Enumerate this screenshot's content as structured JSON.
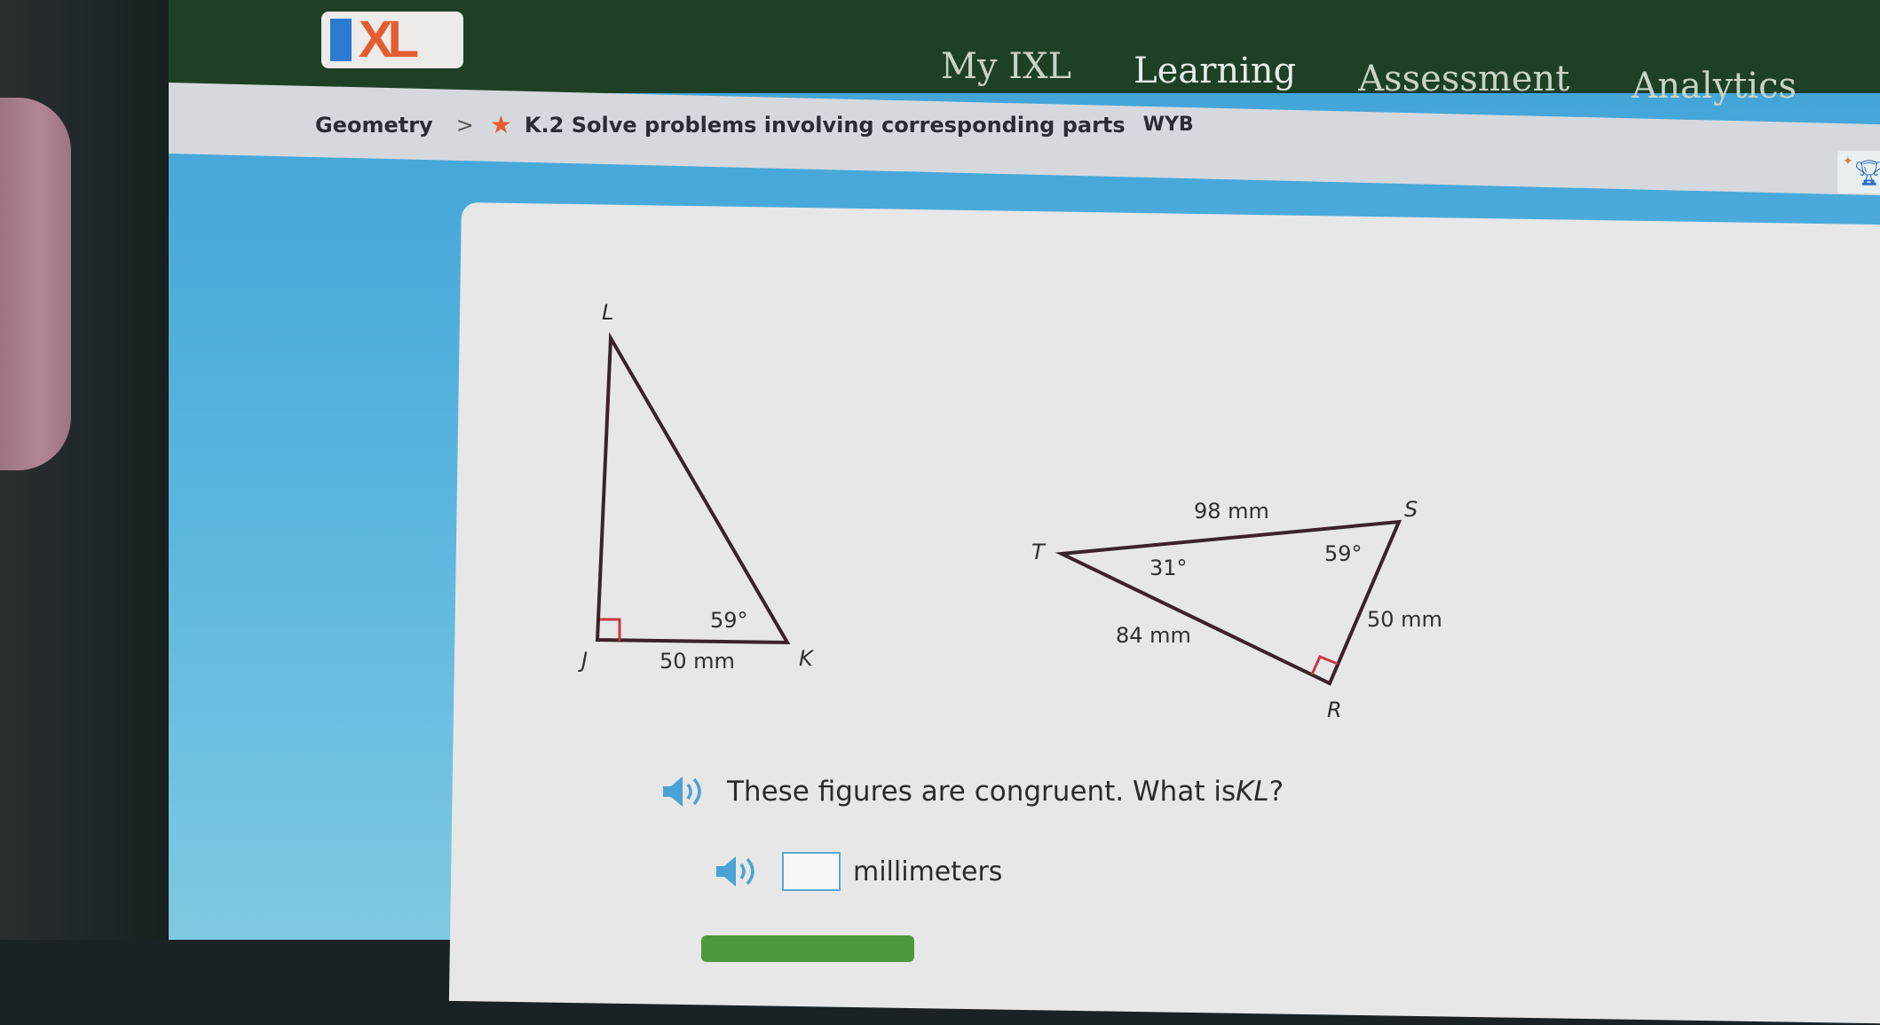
{
  "app": {
    "logo_text": "XL",
    "brand_colors": {
      "topbar": "#1e4126",
      "logo_blue": "#2b7bd2",
      "logo_orange": "#e35d31",
      "accent_blue": "#3fa1d8"
    }
  },
  "nav": {
    "items": [
      {
        "label": "My IXL",
        "active": false
      },
      {
        "label": "Learning",
        "active": true
      },
      {
        "label": "Assessment",
        "active": false
      },
      {
        "label": "Analytics",
        "active": false
      }
    ]
  },
  "breadcrumb": {
    "root": "Geometry",
    "separator": ">",
    "skill": "K.2 Solve problems involving corresponding parts",
    "skill_code": "WYB"
  },
  "figures": {
    "triangle_jkl": {
      "vertices": {
        "L": "L",
        "J": "J",
        "K": "K"
      },
      "labels": {
        "angle_k": "59°",
        "side_jk": "50 mm"
      },
      "right_angle_at": "J"
    },
    "triangle_rst": {
      "vertices": {
        "T": "T",
        "S": "S",
        "R": "R"
      },
      "labels": {
        "side_ts": "98 mm",
        "angle_s": "59°",
        "angle_t": "31°",
        "side_tr": "84 mm",
        "side_sr": "50 mm"
      },
      "right_angle_at": "R"
    }
  },
  "question": {
    "prefix": "These figures are congruent. What is ",
    "segment": "KL",
    "suffix": "?"
  },
  "answer": {
    "value": "",
    "placeholder": "",
    "unit": "millimeters"
  }
}
